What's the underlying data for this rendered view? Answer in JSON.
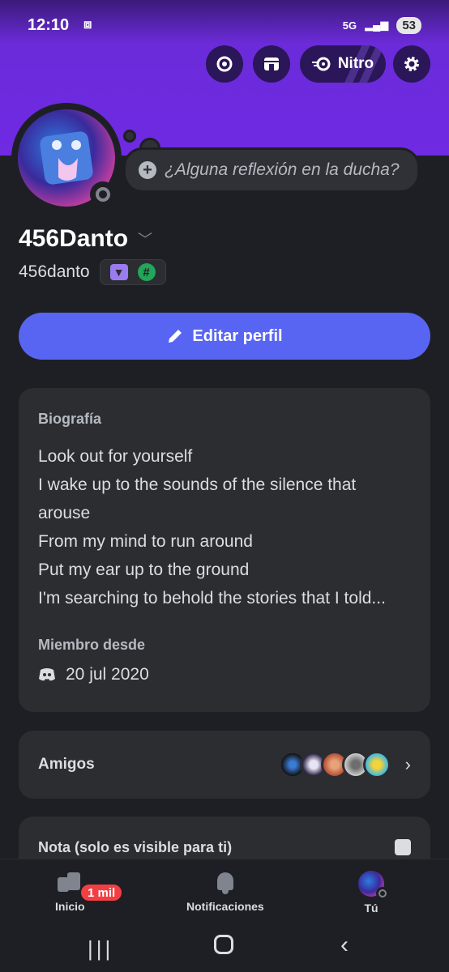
{
  "status_bar": {
    "time": "12:10",
    "network": "5G",
    "battery": "53"
  },
  "top_actions": {
    "nitro_label": "Nitro"
  },
  "profile": {
    "thought_placeholder": "¿Alguna reflexión en la ducha?",
    "display_name": "456Danto",
    "username": "456danto"
  },
  "edit_button": {
    "label": "Editar perfil"
  },
  "bio": {
    "heading": "Biografía",
    "lines": [
      "Look out for yourself",
      "I wake up to the sounds of the silence that",
      "arouse",
      "From my mind to run around",
      "Put my ear up to the ground",
      "I'm searching to behold the stories that I told..."
    ],
    "member_since_heading": "Miembro desde",
    "member_since_date": "20 jul 2020"
  },
  "friends": {
    "label": "Amigos"
  },
  "note": {
    "heading": "Nota (solo es visible para ti)"
  },
  "bottom_nav": {
    "home_label": "Inicio",
    "home_badge": "1 mil",
    "notifications_label": "Notificaciones",
    "you_label": "Tú"
  },
  "colors": {
    "banner": "#6f2ae3",
    "accent_button": "#5865f2",
    "background": "#1e1f24",
    "card": "#2b2d31",
    "badge_red": "#f23f43"
  }
}
